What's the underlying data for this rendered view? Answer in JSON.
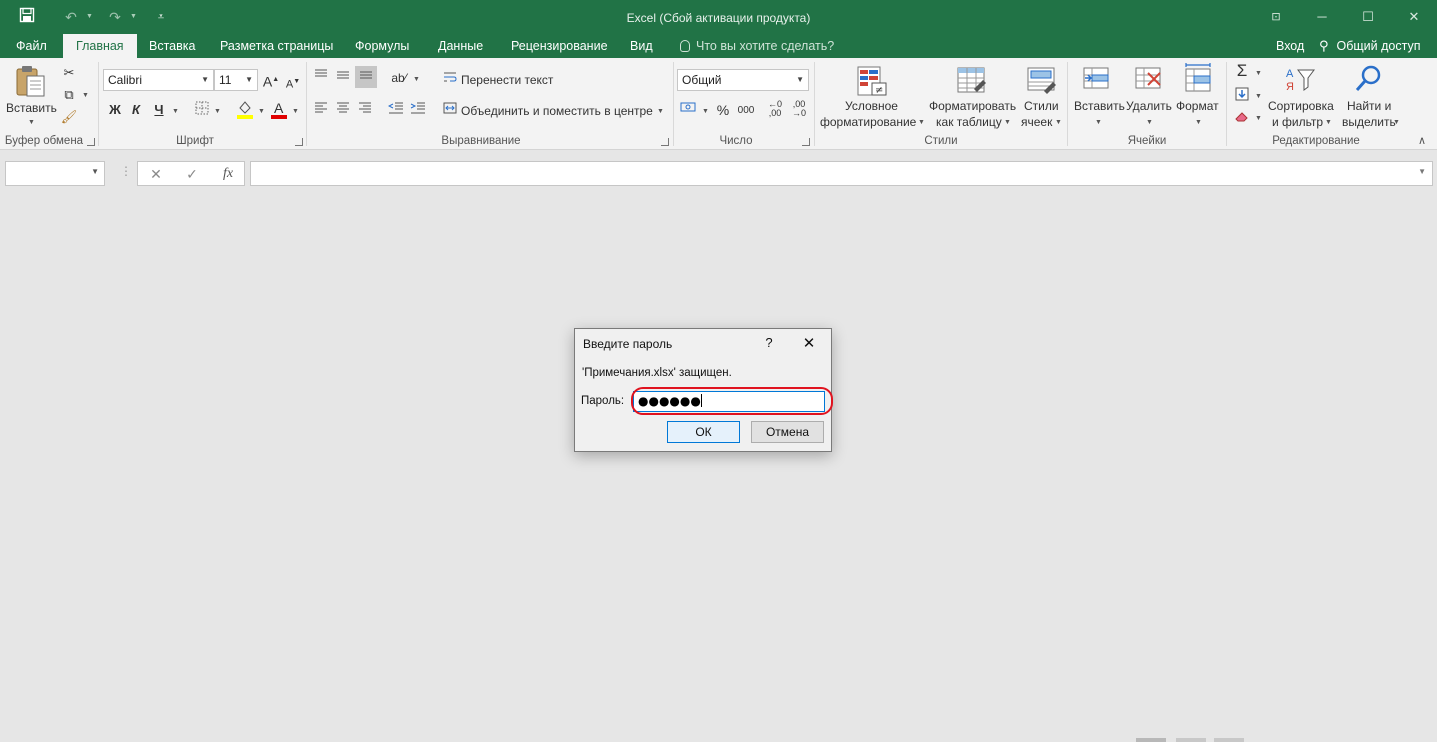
{
  "title_bar": {
    "title": "Excel (Сбой активации продукта)",
    "save_icon": "save-icon",
    "undo_icon": "undo-icon",
    "redo_icon": "redo-icon",
    "customize_icon": "customize-qat-icon",
    "minimize": "─",
    "maximize": "☐",
    "close": "✕"
  },
  "tabs": {
    "file": "Файл",
    "home": "Главная",
    "insert": "Вставка",
    "page_layout": "Разметка страницы",
    "formulas": "Формулы",
    "data": "Данные",
    "review": "Рецензирование",
    "view": "Вид",
    "tell_me": "Что вы хотите сделать?",
    "sign_in": "Вход",
    "share": "Общий доступ"
  },
  "ribbon": {
    "clipboard": {
      "label": "Буфер обмена",
      "paste": "Вставить"
    },
    "font": {
      "label": "Шрифт",
      "font_name": "Calibri",
      "font_size": "11",
      "bold": "Ж",
      "italic": "К",
      "underline": "Ч"
    },
    "alignment": {
      "label": "Выравнивание",
      "wrap_text": "Перенести текст",
      "merge_center": "Объединить и поместить в центре"
    },
    "number": {
      "label": "Число",
      "format": "Общий",
      "percent": "%",
      "comma": "000"
    },
    "styles": {
      "label": "Стили",
      "conditional_1": "Условное",
      "conditional_2": "форматирование",
      "format_table_1": "Форматировать",
      "format_table_2": "как таблицу",
      "cell_styles_1": "Стили",
      "cell_styles_2": "ячеек"
    },
    "cells": {
      "label": "Ячейки",
      "insert": "Вставить",
      "delete": "Удалить",
      "format": "Формат"
    },
    "editing": {
      "label": "Редактирование",
      "sort_1": "Сортировка",
      "sort_2": "и фильтр",
      "find_1": "Найти и",
      "find_2": "выделить"
    }
  },
  "formula_bar": {
    "cancel": "✕",
    "enter": "✓",
    "fx": "fx",
    "name_box_value": "",
    "formula_value": ""
  },
  "dialog": {
    "title": "Введите пароль",
    "help": "?",
    "close": "✕",
    "message": "'Примечания.xlsx' защищен.",
    "password_label": "Пароль:",
    "password_value": "●●●●●●",
    "ok": "ОК",
    "cancel": "Отмена",
    "highlight_color": "#e0131f"
  },
  "colors": {
    "excel_green": "#217346",
    "ribbon_bg": "#f3f3f3",
    "workspace_bg": "#e6e6e6"
  }
}
